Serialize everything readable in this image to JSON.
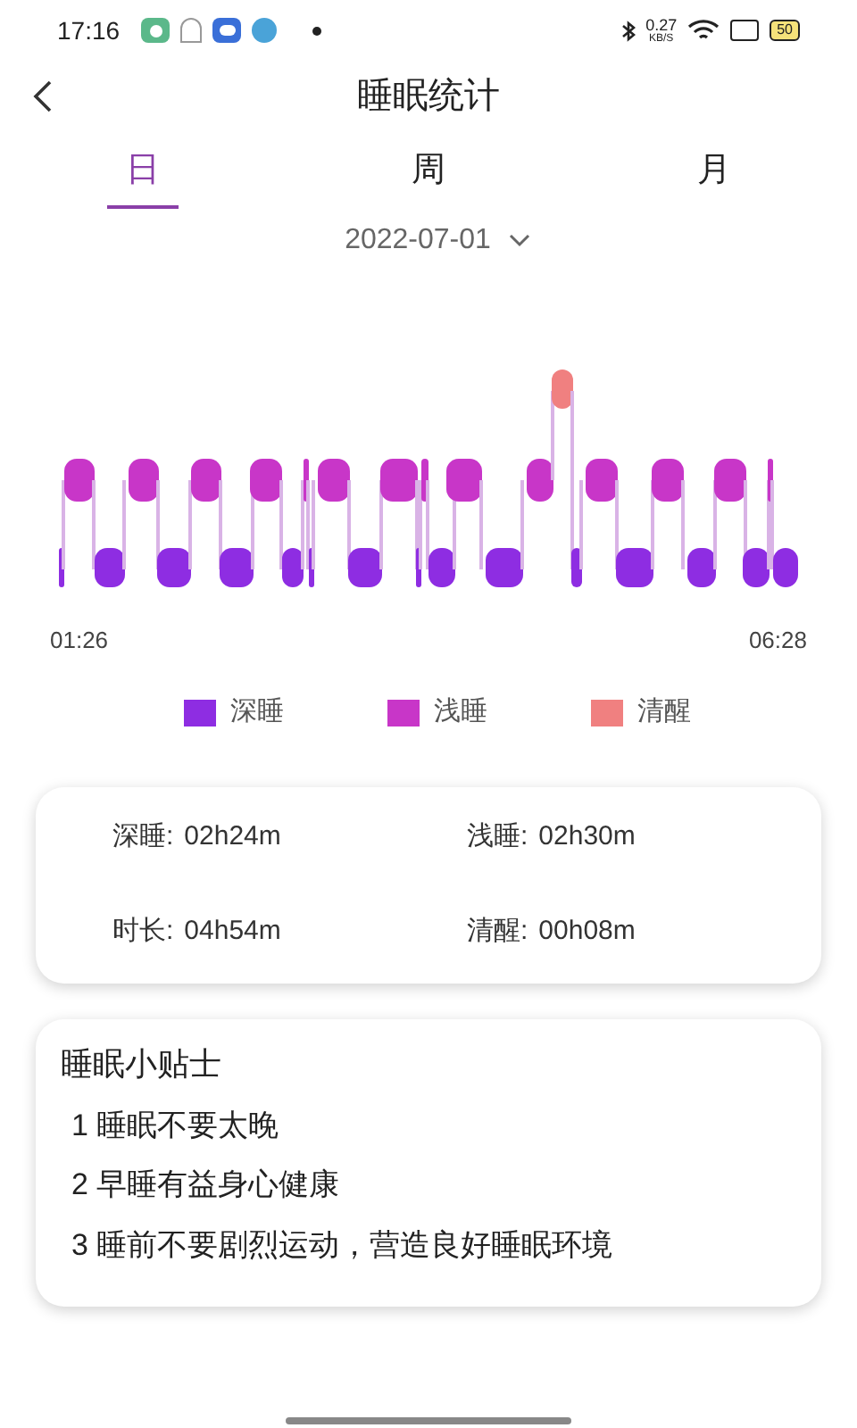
{
  "status_bar": {
    "time": "17:16",
    "speed": "0.27",
    "speed_unit": "KB/S",
    "battery": "50"
  },
  "header": {
    "title": "睡眠统计"
  },
  "tabs": [
    {
      "label": "日",
      "selected": true
    },
    {
      "label": "周",
      "selected": false
    },
    {
      "label": "月",
      "selected": false
    }
  ],
  "date": "2022-07-01",
  "chart": {
    "start_time": "01:26",
    "end_time": "06:28"
  },
  "legend": [
    {
      "label": "深睡",
      "color": "#8e2de2"
    },
    {
      "label": "浅睡",
      "color": "#c836c8"
    },
    {
      "label": "清醒",
      "color": "#f08080"
    }
  ],
  "summary": [
    {
      "label": "深睡:",
      "value": "02h24m"
    },
    {
      "label": "浅睡:",
      "value": "02h30m"
    },
    {
      "label": "时长:",
      "value": "04h54m"
    },
    {
      "label": "清醒:",
      "value": "00h08m"
    }
  ],
  "tips": {
    "title": "睡眠小贴士",
    "items": [
      "1 睡眠不要太晚",
      "2 早睡有益身心健康",
      "3 睡前不要剧烈运动，营造良好睡眠环境"
    ]
  }
}
